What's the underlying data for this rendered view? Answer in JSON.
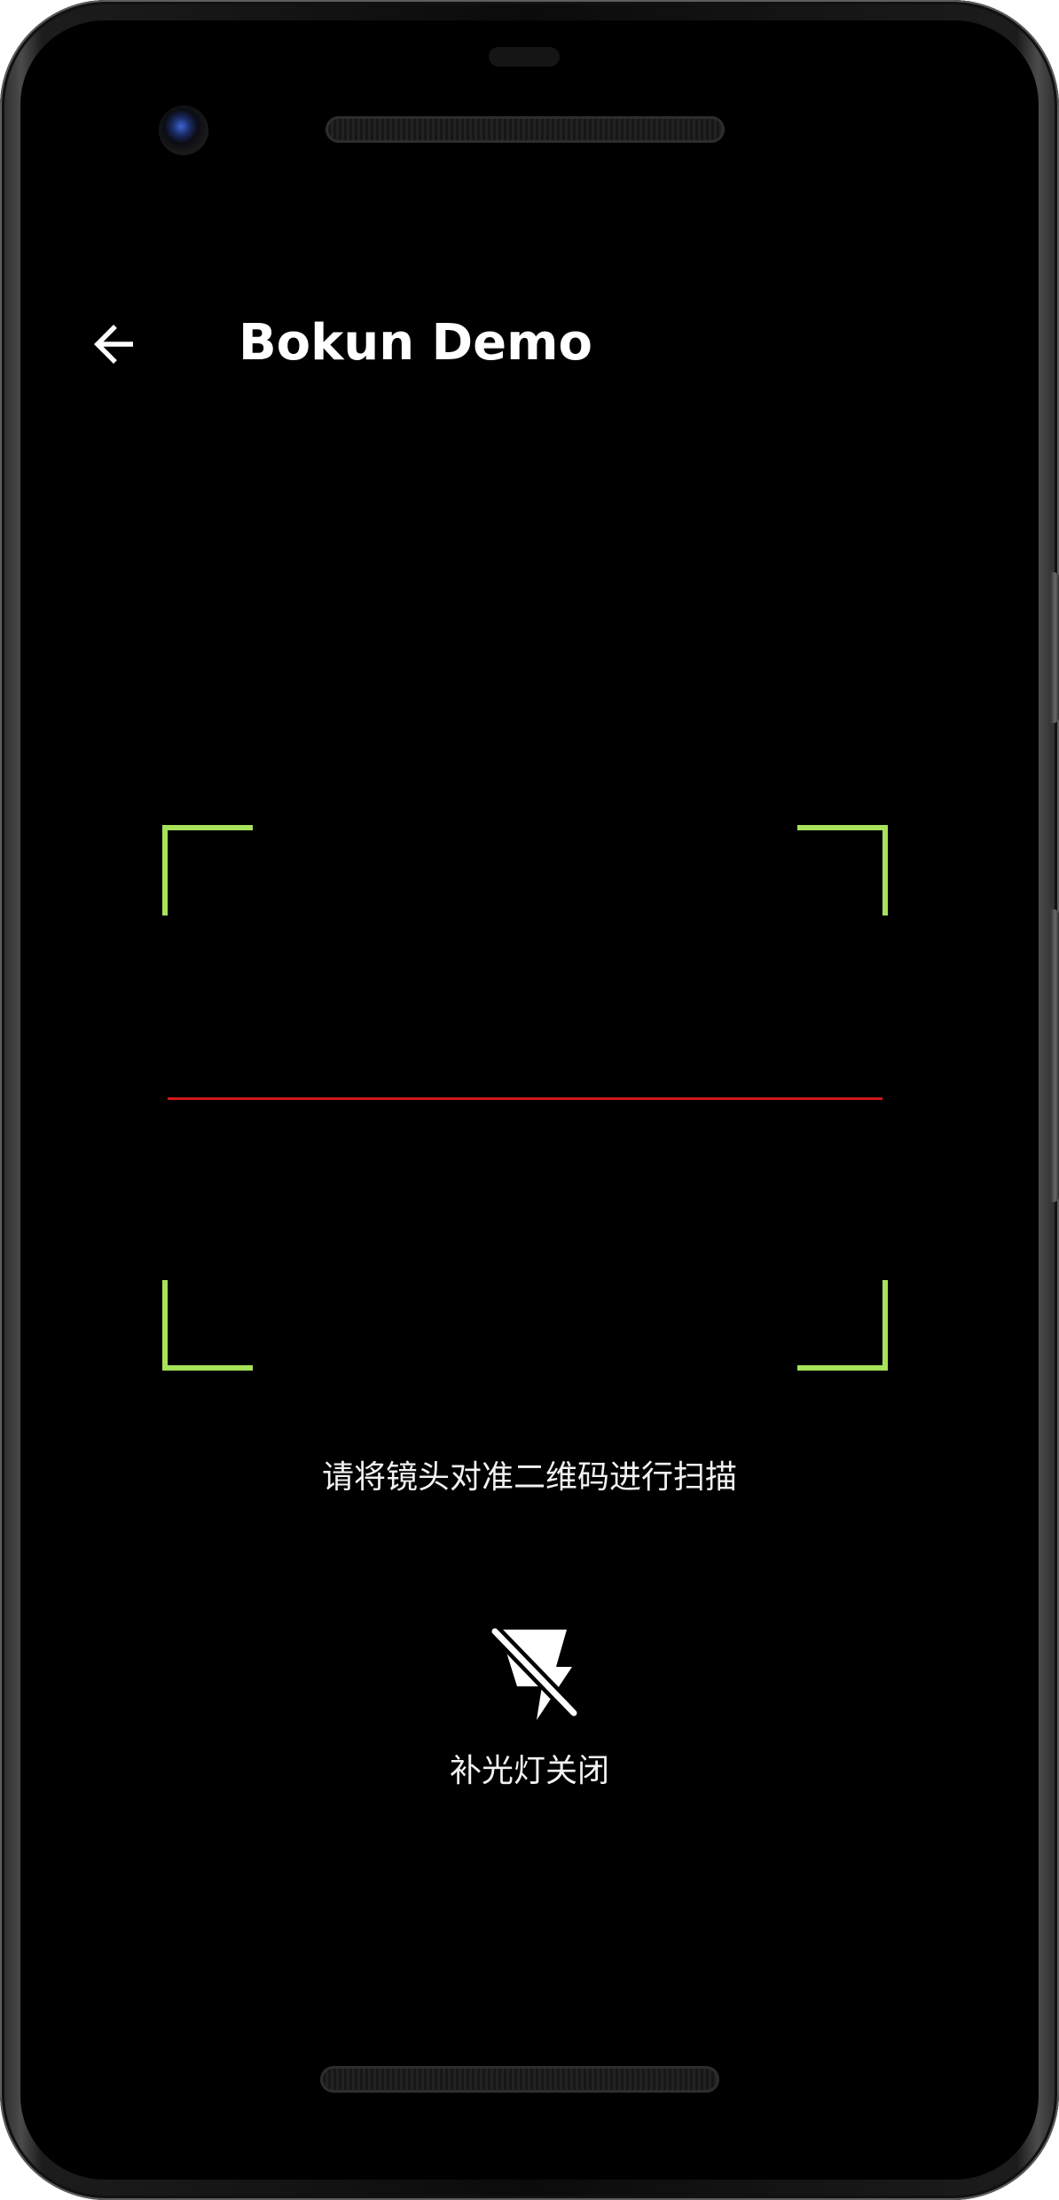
{
  "device": {
    "accent_color": "#a6e35a",
    "scan_line_color": "#d01717",
    "screen_background": "#000000"
  },
  "toolbar": {
    "back_icon": "arrow-left-icon",
    "title": "Bokun Demo"
  },
  "scanner": {
    "hint": "请将镜头对准二维码进行扫描",
    "flash": {
      "icon": "flash-off-icon",
      "label": "补光灯关闭"
    }
  }
}
